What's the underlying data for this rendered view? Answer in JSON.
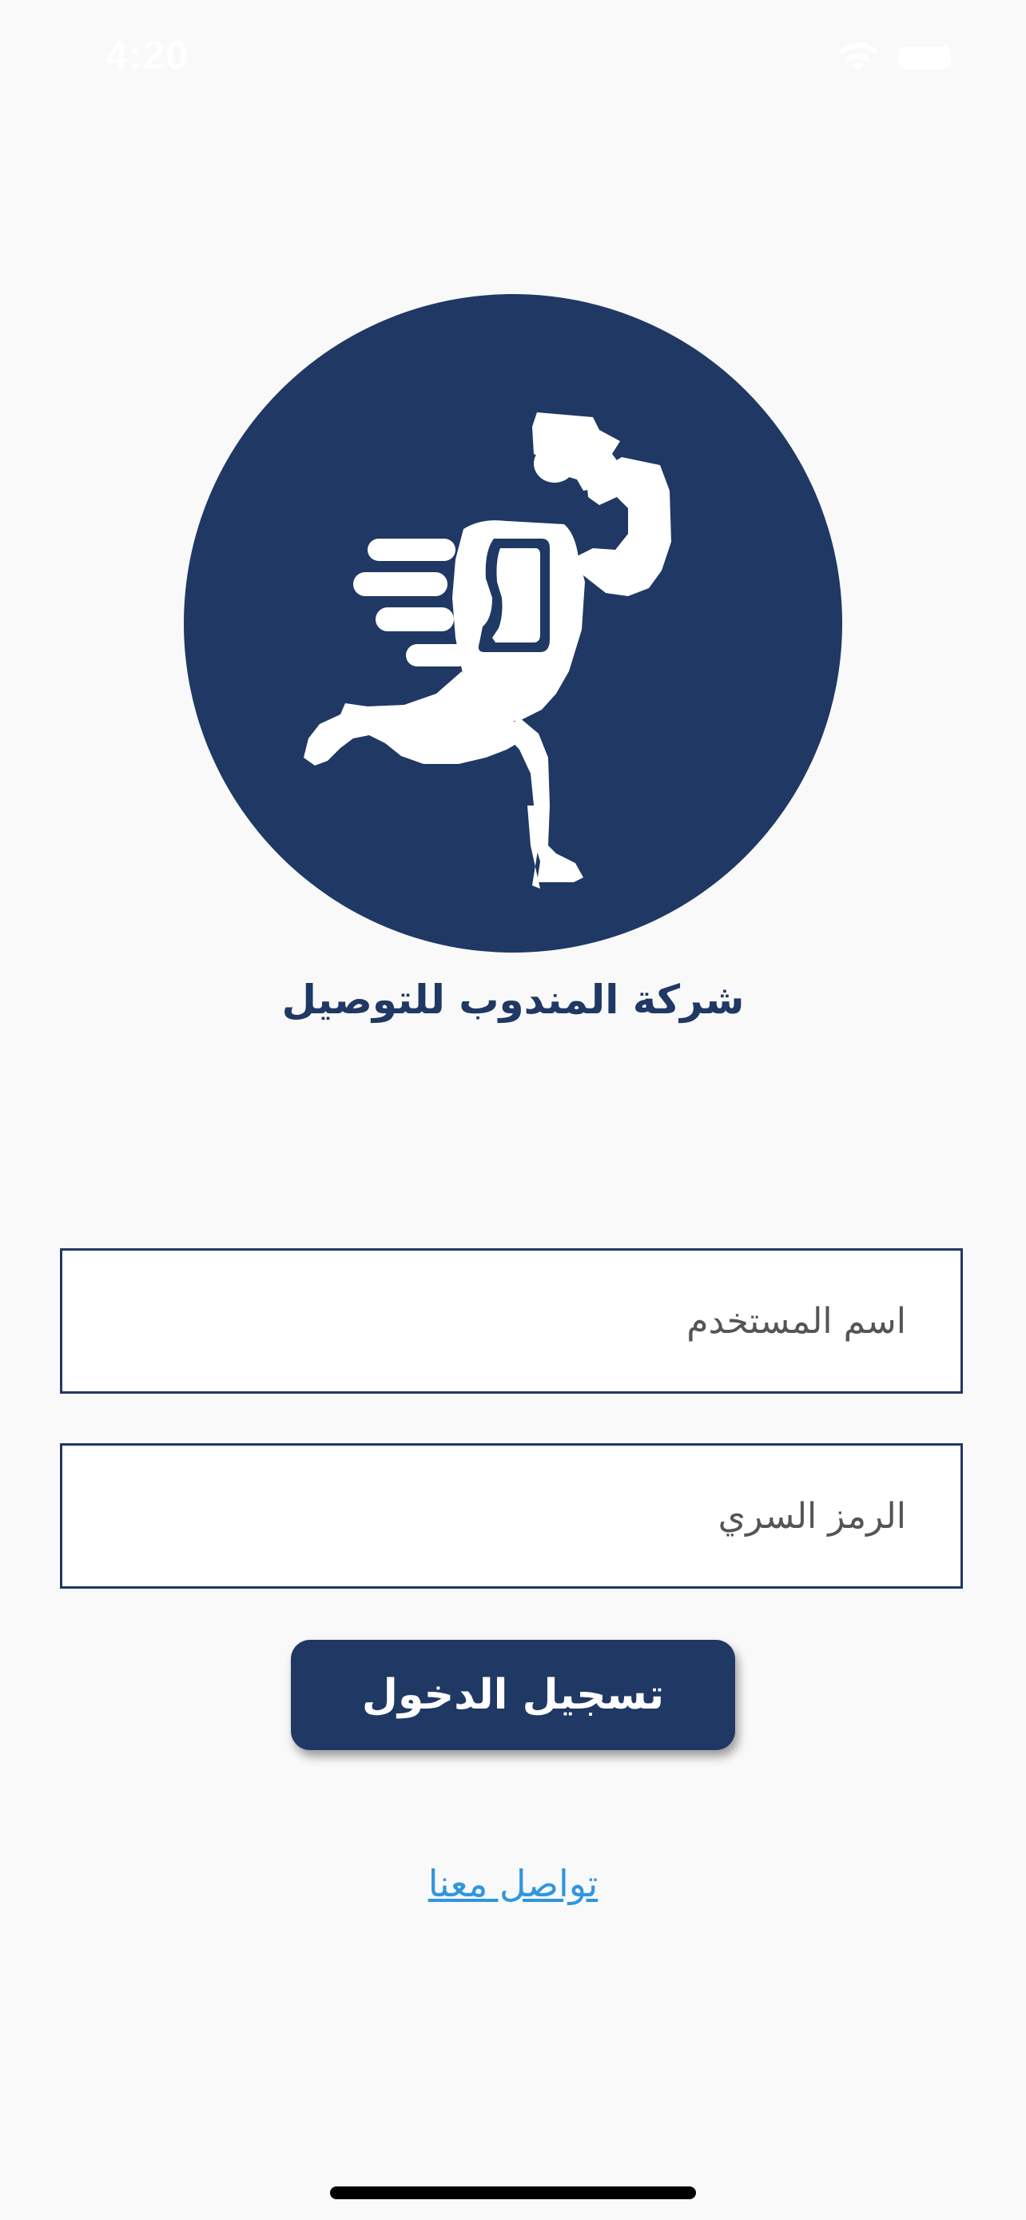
{
  "status_bar": {
    "time": "4:20",
    "wifi_icon": "wifi-icon",
    "battery_icon": "battery-icon"
  },
  "logo": {
    "icon": "delivery-runner-icon",
    "background_color": "#203864"
  },
  "company": {
    "name": "شركة المندوب للتوصيل"
  },
  "form": {
    "username_placeholder": "اسم المستخدم",
    "username_value": "",
    "password_placeholder": "الرمز السري",
    "password_value": "",
    "login_label": "تسجيل الدخول"
  },
  "contact": {
    "label": "تواصل معنا"
  },
  "colors": {
    "brand": "#203864",
    "link": "#2f96e0",
    "background": "#f9f9f9"
  }
}
